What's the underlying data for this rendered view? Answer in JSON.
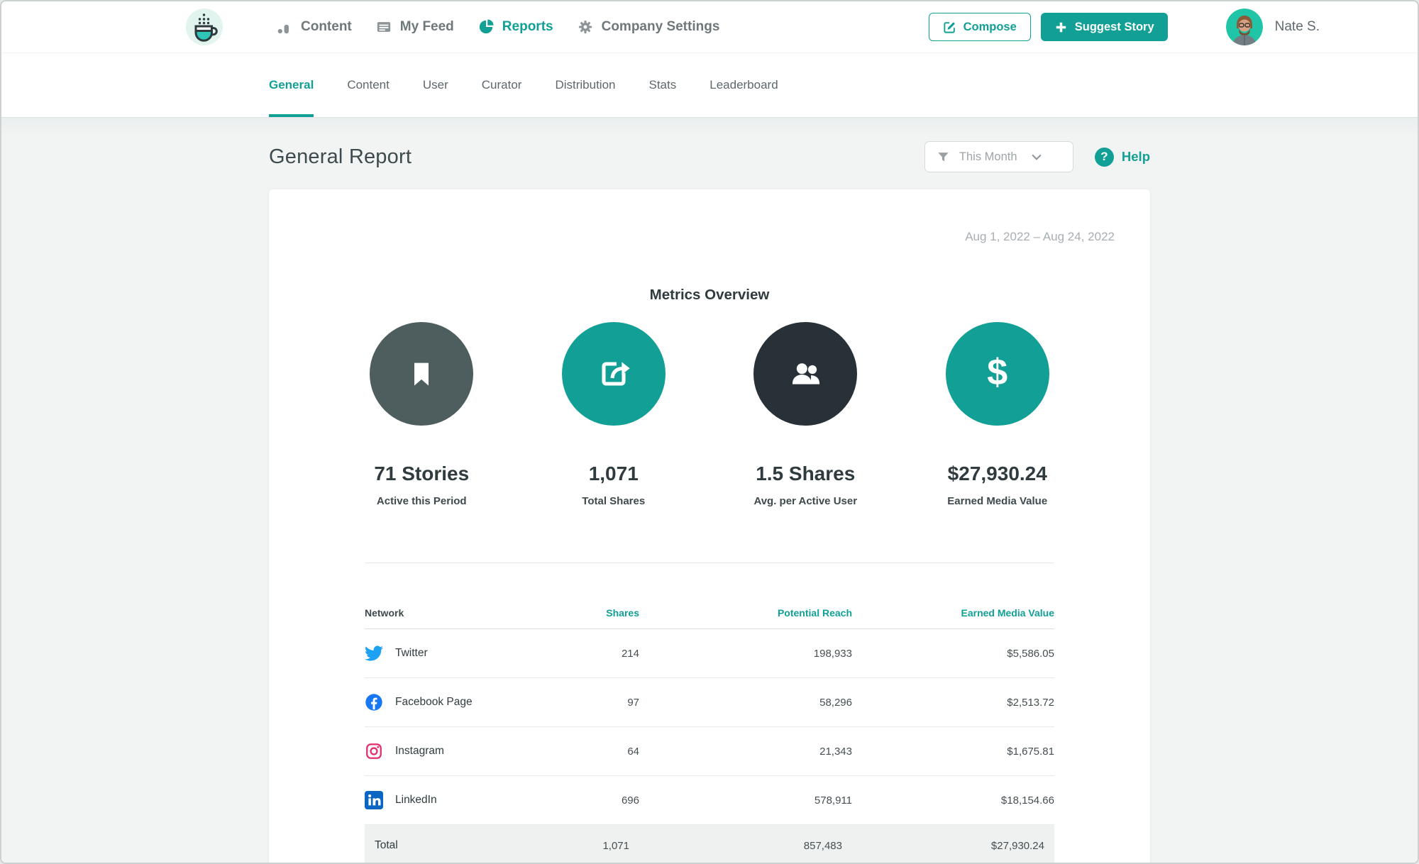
{
  "colors": {
    "teal": "#12a096",
    "teal_bright": "#20c5a8",
    "metric_circle_slate": "#4e5d5e",
    "metric_circle_teal": "#12a096",
    "metric_circle_charcoal": "#273137",
    "twitter_blue": "#1da1f2",
    "facebook_blue": "#1877f2",
    "instagram_pink": "#e1306c",
    "linkedin_blue": "#0a66c2"
  },
  "top_nav": {
    "logo_icon": "coffee-cup-logo-icon",
    "items": [
      {
        "label": "Content",
        "icon": "bar-chart-icon",
        "active": false
      },
      {
        "label": "My Feed",
        "icon": "feed-icon",
        "active": false
      },
      {
        "label": "Reports",
        "icon": "pie-chart-icon",
        "active": true
      },
      {
        "label": "Company Settings",
        "icon": "gear-icon",
        "active": false
      }
    ],
    "compose": {
      "label": "Compose",
      "icon": "compose-icon"
    },
    "suggest_story": {
      "label": "Suggest Story",
      "icon": "plus-icon"
    },
    "user": {
      "name": "Nate S.",
      "icon": "avatar"
    }
  },
  "sub_nav": {
    "tabs": [
      {
        "label": "General",
        "active": true
      },
      {
        "label": "Content",
        "active": false
      },
      {
        "label": "User",
        "active": false
      },
      {
        "label": "Curator",
        "active": false
      },
      {
        "label": "Distribution",
        "active": false
      },
      {
        "label": "Stats",
        "active": false
      },
      {
        "label": "Leaderboard",
        "active": false
      }
    ]
  },
  "report_header": {
    "title": "General Report",
    "filter": {
      "label": "This Month",
      "icon": "funnel-icon",
      "chevron_icon": "chevron-down-icon"
    },
    "help": {
      "label": "Help",
      "glyph": "?",
      "icon": "question-circle-icon"
    }
  },
  "card": {
    "date_range": "Aug 1, 2022 – Aug 24, 2022",
    "metrics_title": "Metrics Overview",
    "metrics": [
      {
        "icon": "bookmark-icon",
        "circle_color": "#4e5d5e",
        "value": "71 Stories",
        "label": "Active this Period"
      },
      {
        "icon": "share-icon",
        "circle_color": "#12a096",
        "value": "1,071",
        "label": "Total Shares"
      },
      {
        "icon": "users-icon",
        "circle_color": "#273137",
        "value": "1.5 Shares",
        "label": "Avg. per Active User"
      },
      {
        "icon": "dollar-icon",
        "glyph": "$",
        "circle_color": "#12a096",
        "value": "$27,930.24",
        "label": "Earned Media Value"
      }
    ],
    "table": {
      "columns": [
        "Network",
        "Shares",
        "Potential Reach",
        "Earned Media Value"
      ],
      "rows": [
        {
          "network": "Twitter",
          "icon": "twitter-icon",
          "shares": "214",
          "reach": "198,933",
          "emv": "$5,586.05"
        },
        {
          "network": "Facebook Page",
          "icon": "facebook-icon",
          "shares": "97",
          "reach": "58,296",
          "emv": "$2,513.72"
        },
        {
          "network": "Instagram",
          "icon": "instagram-icon",
          "shares": "64",
          "reach": "21,343",
          "emv": "$1,675.81"
        },
        {
          "network": "LinkedIn",
          "icon": "linkedin-icon",
          "shares": "696",
          "reach": "578,911",
          "emv": "$18,154.66"
        }
      ],
      "total": {
        "label": "Total",
        "shares": "1,071",
        "reach": "857,483",
        "emv": "$27,930.24"
      }
    }
  }
}
